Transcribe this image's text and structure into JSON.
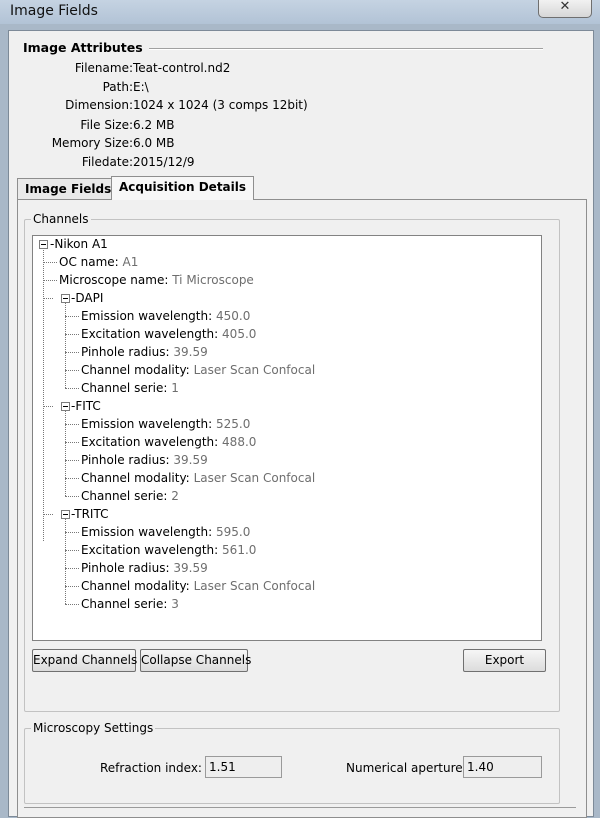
{
  "window": {
    "title": "Image Fields",
    "close_glyph": "✕"
  },
  "attributes": {
    "title": "Image Attributes",
    "rows": [
      {
        "label": "Filename:",
        "value": "Teat-control.nd2"
      },
      {
        "label": "Path:",
        "value": "E:\\"
      },
      {
        "label": "Dimension:",
        "value": "1024 x 1024 (3 comps 12bit)"
      },
      {
        "label": "File Size:",
        "value": "6.2 MB"
      },
      {
        "label": "Memory Size:",
        "value": "6.0 MB"
      },
      {
        "label": "Filedate:",
        "value": "2015/12/9"
      }
    ]
  },
  "tabs": [
    {
      "label": "Image Fields",
      "active": false
    },
    {
      "label": "Acquisition Details",
      "active": true
    }
  ],
  "channels": {
    "group_label": "Channels",
    "root": "Nikon A1",
    "root_props": [
      {
        "label": "OC name:",
        "value": "A1"
      },
      {
        "label": "Microscope name:",
        "value": "Ti Microscope"
      }
    ],
    "items": [
      {
        "name": "DAPI",
        "props": [
          {
            "label": "Emission wavelength:",
            "value": "450.0"
          },
          {
            "label": "Excitation wavelength:",
            "value": "405.0"
          },
          {
            "label": "Pinhole radius:",
            "value": "39.59"
          },
          {
            "label": "Channel modality:",
            "value": "Laser Scan Confocal"
          },
          {
            "label": "Channel serie:",
            "value": "1"
          }
        ]
      },
      {
        "name": "FITC",
        "props": [
          {
            "label": "Emission wavelength:",
            "value": "525.0"
          },
          {
            "label": "Excitation wavelength:",
            "value": "488.0"
          },
          {
            "label": "Pinhole radius:",
            "value": "39.59"
          },
          {
            "label": "Channel modality:",
            "value": "Laser Scan Confocal"
          },
          {
            "label": "Channel serie:",
            "value": "2"
          }
        ]
      },
      {
        "name": "TRITC",
        "props": [
          {
            "label": "Emission wavelength:",
            "value": "595.0"
          },
          {
            "label": "Excitation wavelength:",
            "value": "561.0"
          },
          {
            "label": "Pinhole radius:",
            "value": "39.59"
          },
          {
            "label": "Channel modality:",
            "value": "Laser Scan Confocal"
          },
          {
            "label": "Channel serie:",
            "value": "3"
          }
        ]
      }
    ],
    "buttons": {
      "expand": "Expand Channels",
      "collapse": "Collapse Channels",
      "export": "Export"
    }
  },
  "microscopy": {
    "group_label": "Microscopy Settings",
    "refraction_label": "Refraction index:",
    "refraction_value": "1.51",
    "aperture_label": "Numerical aperture:",
    "aperture_value": "1.40"
  }
}
